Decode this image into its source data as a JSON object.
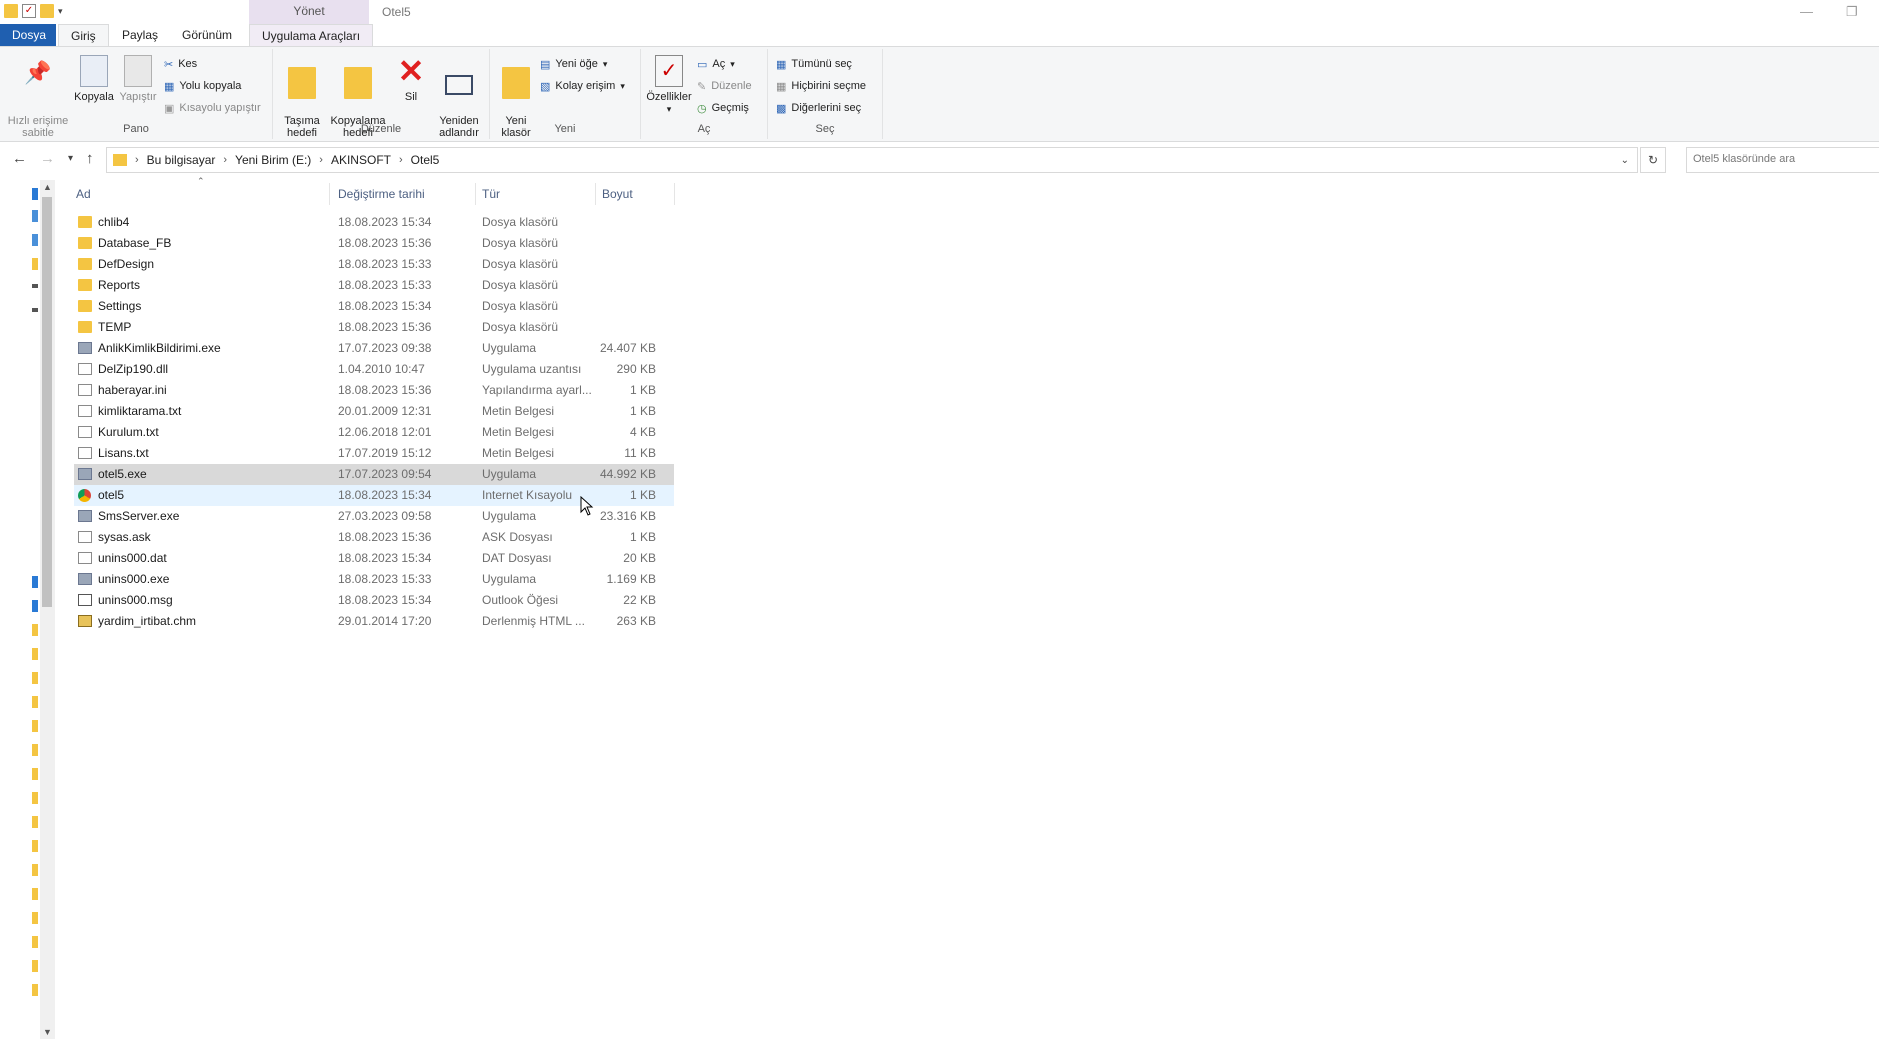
{
  "window": {
    "title": "Otel5",
    "contextual_group": "Yönet"
  },
  "tabs": {
    "file": "Dosya",
    "home": "Giriş",
    "share": "Paylaş",
    "view": "Görünüm",
    "app_tools": "Uygulama Araçları"
  },
  "ribbon": {
    "pano": {
      "label": "Pano",
      "pin": "Hızlı erişime\nsabitle",
      "copy": "Kopyala",
      "paste": "Yapıştır",
      "cut": "Kes",
      "copy_path": "Yolu kopyala",
      "paste_shortcut": "Kısayolu yapıştır"
    },
    "duzenle": {
      "label": "Düzenle",
      "move_to": "Taşıma\nhedefi",
      "copy_to": "Kopyalama\nhedefi",
      "delete": "Sil",
      "rename": "Yeniden\nadlandır"
    },
    "yeni": {
      "label": "Yeni",
      "new_folder": "Yeni\nklasör",
      "new_item": "Yeni öğe",
      "easy_access": "Kolay erişim"
    },
    "ac": {
      "label": "Aç",
      "properties": "Özellikler",
      "open": "Aç",
      "edit": "Düzenle",
      "history": "Geçmiş"
    },
    "sec": {
      "label": "Seç",
      "select_all": "Tümünü seç",
      "select_none": "Hiçbirini seçme",
      "invert": "Diğerlerini seç"
    }
  },
  "address": {
    "crumbs": [
      "Bu bilgisayar",
      "Yeni Birim (E:)",
      "AKINSOFT",
      "Otel5"
    ],
    "search_placeholder": "Otel5 klasöründe ara"
  },
  "columns": {
    "name": "Ad",
    "date": "Değiştirme tarihi",
    "type": "Tür",
    "size": "Boyut"
  },
  "files": [
    {
      "name": "chlib4",
      "date": "18.08.2023 15:34",
      "type": "Dosya klasörü",
      "size": "",
      "icon": "folder"
    },
    {
      "name": "Database_FB",
      "date": "18.08.2023 15:36",
      "type": "Dosya klasörü",
      "size": "",
      "icon": "folder"
    },
    {
      "name": "DefDesign",
      "date": "18.08.2023 15:33",
      "type": "Dosya klasörü",
      "size": "",
      "icon": "folder"
    },
    {
      "name": "Reports",
      "date": "18.08.2023 15:33",
      "type": "Dosya klasörü",
      "size": "",
      "icon": "folder"
    },
    {
      "name": "Settings",
      "date": "18.08.2023 15:34",
      "type": "Dosya klasörü",
      "size": "",
      "icon": "folder"
    },
    {
      "name": "TEMP",
      "date": "18.08.2023 15:36",
      "type": "Dosya klasörü",
      "size": "",
      "icon": "folder"
    },
    {
      "name": "AnlikKimlikBildirimi.exe",
      "date": "17.07.2023 09:38",
      "type": "Uygulama",
      "size": "24.407 KB",
      "icon": "exe"
    },
    {
      "name": "DelZip190.dll",
      "date": "1.04.2010 10:47",
      "type": "Uygulama uzantısı",
      "size": "290 KB",
      "icon": "file"
    },
    {
      "name": "haberayar.ini",
      "date": "18.08.2023 15:36",
      "type": "Yapılandırma ayarl...",
      "size": "1 KB",
      "icon": "file"
    },
    {
      "name": "kimliktarama.txt",
      "date": "20.01.2009 12:31",
      "type": "Metin Belgesi",
      "size": "1 KB",
      "icon": "file"
    },
    {
      "name": "Kurulum.txt",
      "date": "12.06.2018 12:01",
      "type": "Metin Belgesi",
      "size": "4 KB",
      "icon": "file"
    },
    {
      "name": "Lisans.txt",
      "date": "17.07.2019 15:12",
      "type": "Metin Belgesi",
      "size": "11 KB",
      "icon": "file"
    },
    {
      "name": "otel5.exe",
      "date": "17.07.2023 09:54",
      "type": "Uygulama",
      "size": "44.992 KB",
      "icon": "exe",
      "state": "selected"
    },
    {
      "name": "otel5",
      "date": "18.08.2023 15:34",
      "type": "Internet Kısayolu",
      "size": "1 KB",
      "icon": "chrome",
      "state": "hover"
    },
    {
      "name": "SmsServer.exe",
      "date": "27.03.2023 09:58",
      "type": "Uygulama",
      "size": "23.316 KB",
      "icon": "exe"
    },
    {
      "name": "sysas.ask",
      "date": "18.08.2023 15:36",
      "type": "ASK Dosyası",
      "size": "1 KB",
      "icon": "file"
    },
    {
      "name": "unins000.dat",
      "date": "18.08.2023 15:34",
      "type": "DAT Dosyası",
      "size": "20 KB",
      "icon": "file"
    },
    {
      "name": "unins000.exe",
      "date": "18.08.2023 15:33",
      "type": "Uygulama",
      "size": "1.169 KB",
      "icon": "exe"
    },
    {
      "name": "unins000.msg",
      "date": "18.08.2023 15:34",
      "type": "Outlook Öğesi",
      "size": "22 KB",
      "icon": "msg"
    },
    {
      "name": "yardim_irtibat.chm",
      "date": "29.01.2014 17:20",
      "type": "Derlenmiş HTML ...",
      "size": "263 KB",
      "icon": "chm"
    }
  ]
}
